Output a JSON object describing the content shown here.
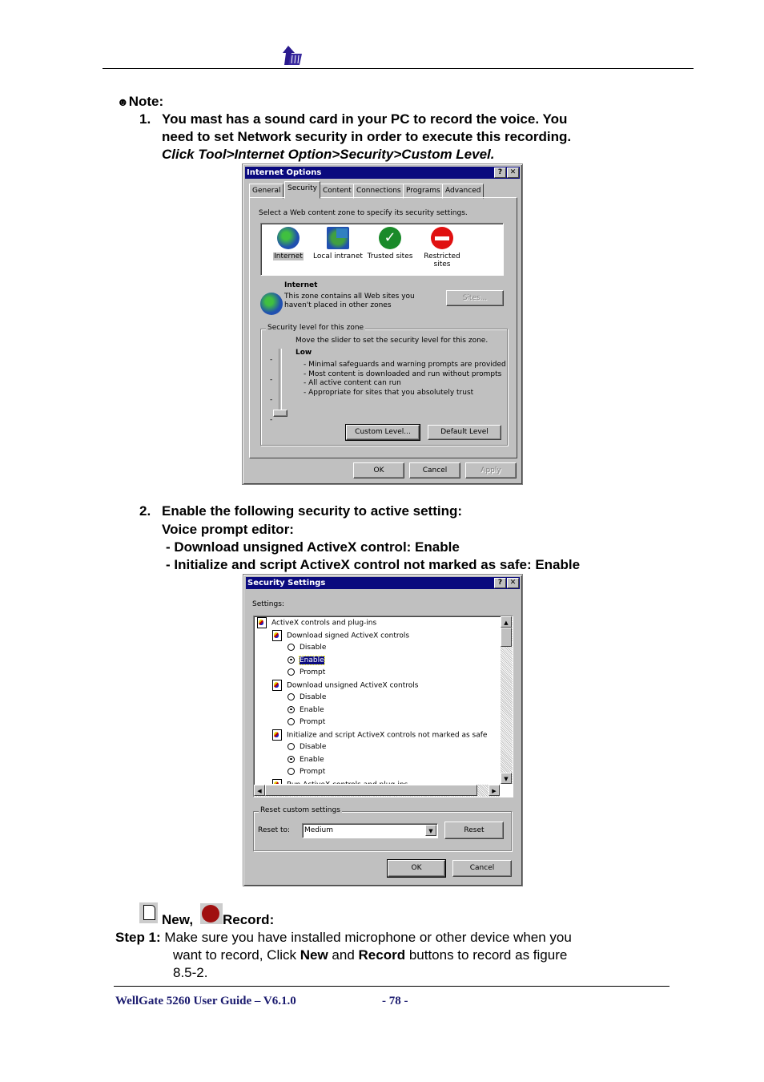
{
  "header": {
    "logo": "company-logo"
  },
  "note": {
    "bullet": "☻",
    "title": "Note:",
    "item1": {
      "num": "1.",
      "line1": "You mast has a sound card in your PC to record the voice. You",
      "line2": "need to set Network security in order to execute this recording.",
      "line3": "Click Tool>Internet Option>Security>Custom Level."
    },
    "item2": {
      "num": "2.",
      "line1": "Enable the following security to active setting:",
      "line2": "Voice prompt editor:",
      "line3": "- Download unsigned ActiveX control: Enable",
      "line4": "- Initialize and script ActiveX control not marked as safe: Enable"
    }
  },
  "internet_options": {
    "title": "Internet Options",
    "help": "?",
    "close": "✕",
    "tabs": [
      "General",
      "Security",
      "Content",
      "Connections",
      "Programs",
      "Advanced"
    ],
    "selected_tab": "Security",
    "zone_prompt": "Select a Web content zone to specify its security settings.",
    "zones": [
      {
        "label": "Internet",
        "icon": "globe-icon",
        "selected": true
      },
      {
        "label": "Local intranet",
        "icon": "intranet-icon",
        "selected": false
      },
      {
        "label": "Trusted sites",
        "icon": "checkmark-icon",
        "selected": false
      },
      {
        "label": "Restricted sites",
        "icon": "no-entry-icon",
        "selected": false
      }
    ],
    "zone_name": "Internet",
    "zone_desc1": "This zone contains all Web sites you",
    "zone_desc2": "haven't placed in other zones",
    "sites_btn": "Sites...",
    "level_group": "Security level for this zone",
    "level_hint": "Move the slider to set the security level for this zone.",
    "level_name": "Low",
    "level_points": [
      "- Minimal safeguards and warning prompts are provided",
      "- Most content is downloaded and run without prompts",
      "- All active content can run",
      "- Appropriate for sites that you absolutely trust"
    ],
    "custom_level_btn": "Custom Level...",
    "default_level_btn": "Default Level",
    "ok": "OK",
    "cancel": "Cancel",
    "apply": "Apply"
  },
  "security_settings": {
    "title": "Security Settings",
    "help": "?",
    "close": "✕",
    "settings_label": "Settings:",
    "tree": [
      {
        "type": "folder",
        "level": 0,
        "label": "ActiveX controls and plug-ins"
      },
      {
        "type": "folder",
        "level": 1,
        "label": "Download signed ActiveX controls"
      },
      {
        "type": "radio",
        "level": 2,
        "label": "Disable",
        "checked": false
      },
      {
        "type": "radio",
        "level": 2,
        "label": "Enable",
        "checked": true,
        "highlighted": true
      },
      {
        "type": "radio",
        "level": 2,
        "label": "Prompt",
        "checked": false
      },
      {
        "type": "folder",
        "level": 1,
        "label": "Download unsigned ActiveX controls"
      },
      {
        "type": "radio",
        "level": 2,
        "label": "Disable",
        "checked": false
      },
      {
        "type": "radio",
        "level": 2,
        "label": "Enable",
        "checked": true
      },
      {
        "type": "radio",
        "level": 2,
        "label": "Prompt",
        "checked": false
      },
      {
        "type": "folder",
        "level": 1,
        "label": "Initialize and script ActiveX controls not marked as safe"
      },
      {
        "type": "radio",
        "level": 2,
        "label": "Disable",
        "checked": false
      },
      {
        "type": "radio",
        "level": 2,
        "label": "Enable",
        "checked": true
      },
      {
        "type": "radio",
        "level": 2,
        "label": "Prompt",
        "checked": false
      },
      {
        "type": "folder",
        "level": 1,
        "label": "Run ActiveX controls and plug-ins"
      }
    ],
    "reset_group": "Reset custom settings",
    "reset_to_label": "Reset to:",
    "reset_to_value": "Medium",
    "reset_btn": "Reset",
    "ok": "OK",
    "cancel": "Cancel"
  },
  "record": {
    "new_label": "New,",
    "record_label": "Record:",
    "step_label": "Step 1:",
    "step_text1": "Make sure you have installed microphone or other device when you",
    "step_text2a": "want to record, Click ",
    "step_new": "New",
    "step_text2b": " and ",
    "step_record": "Record",
    "step_text2c": " buttons to record as figure",
    "step_text3": "8.5-2."
  },
  "footer": {
    "doc_title": "WellGate 5260 User Guide – V6.1.0",
    "page": "- 78 -"
  }
}
